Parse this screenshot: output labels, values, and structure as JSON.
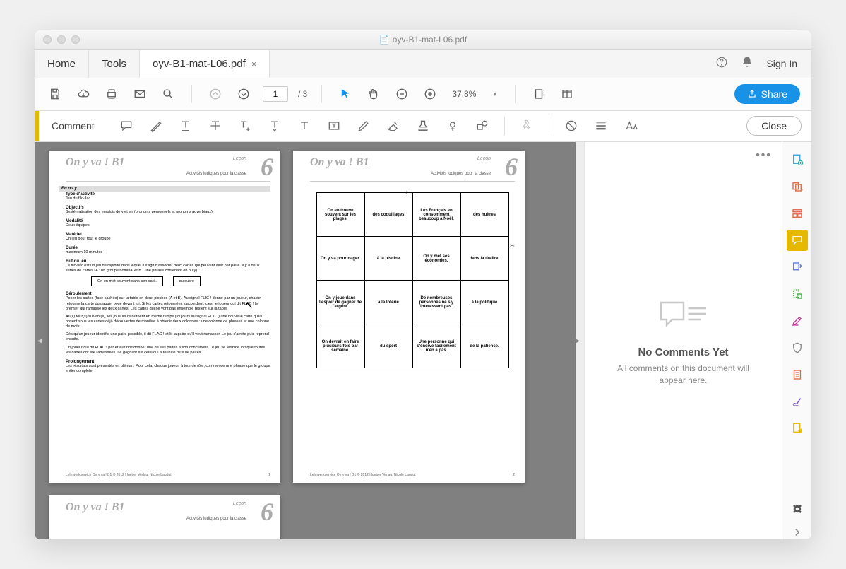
{
  "window": {
    "title": "oyv-B1-mat-L06.pdf"
  },
  "tabs": {
    "home": "Home",
    "tools": "Tools",
    "doc": "oyv-B1-mat-L06.pdf"
  },
  "header_right": {
    "signin": "Sign In"
  },
  "toolbar": {
    "page_current": "1",
    "page_total": "/ 3",
    "zoom": "37.8%",
    "share": "Share"
  },
  "commentbar": {
    "label": "Comment",
    "close": "Close"
  },
  "page1": {
    "title": "On y va ! B1",
    "lecon": "Leçon",
    "subtitle": "Activités ludiques pour la classe",
    "en_ou_y": "En ou y",
    "type_act": "Type d'activité",
    "type_act_v": "Jeu du flic-flac",
    "objectifs": "Objectifs",
    "objectifs_v": "Systématisation des emplois de y et en (pronoms personnels et pronoms adverbiaux)",
    "modalite": "Modalité",
    "modalite_v": "Deux équipes",
    "materiel": "Matériel",
    "materiel_v": "Un jeu pour tout le groupe",
    "duree": "Durée",
    "duree_v": "maximum 10 minutes",
    "but": "But du jeu",
    "but_v": "Le flic-flac est un jeu de rapidité dans lequel il s'agit d'associer deux cartes qui peuvent aller par paire. Il y a deux séries de cartes (A : un groupe nominal et B : une phrase contenant en ou y).",
    "ex1": "On en met souvent dans son café.",
    "ex2": "du sucre",
    "deroul": "Déroulement",
    "deroul_v1": "Poser les cartes (face cachée) sur la table en deux pioches (A et B). Au signal FLIC ! donné par un joueur, chacun retourne la carte du paquet posé devant lui. Si les cartes retournées s'accordent, c'est le joueur qui dit FLAC ! le premier qui ramasse les deux cartes. Les cartes qui ne vont pas ensemble restent sur la table.",
    "deroul_v2": "Au(x) tour(s) suivant(s), les joueurs retournent en même temps (toujours au signal FLIC !) une nouvelle carte qu'ils posent sous les cartes déjà découvertes de manière à obtenir deux colonnes : une colonne de phrases et une colonne de mots.",
    "deroul_v3": "Dès qu'un joueur identifie une paire possible, il dit FLAC ! et lit la paire qu'il veut ramasser. Le jeu s'arrête puis reprend ensuite.",
    "deroul_v4": "Un joueur qui dit FLAC ! par erreur doit donner une de ses paires à son concurrent. Le jeu se termine lorsque toutes les cartes ont été ramassées. Le gagnant est celui qui a réuni le plus de paires.",
    "prolong": "Prolongement",
    "prolong_v": "Les résultats sont présentés en plénum. Pour cela, chaque joueur, à tour de rôle, commence une phrase que le groupe entier complète.",
    "footer": "Lehrwerkservice On y va ! B1 © 2012 Hueber Verlag, Nicole Laudut",
    "pagenum": "1"
  },
  "page2": {
    "cards": [
      "On en trouve souvent sur les plages.",
      "des coquillages",
      "Les Français en consomment beaucoup à Noël.",
      "des huîtres",
      "On y va pour nager.",
      "à la piscine",
      "On y met ses économies.",
      "dans la tirelire.",
      "On y joue dans l'espoir de gagner de l'argent.",
      "à la loterie",
      "De nombreuses personnes ne s'y intéressent pas.",
      "à la politique",
      "On devrait en faire plusieurs fois par semaine.",
      "du sport",
      "Une personne qui s'énerve facilement n'en a pas.",
      "de la patience."
    ],
    "footer": "Lehrwerkservice On y va ! B1 © 2012 Hueber Verlag, Nicole Laudut",
    "pagenum": "2"
  },
  "comments": {
    "title": "No Comments Yet",
    "subtitle": "All comments on this document will appear here."
  }
}
